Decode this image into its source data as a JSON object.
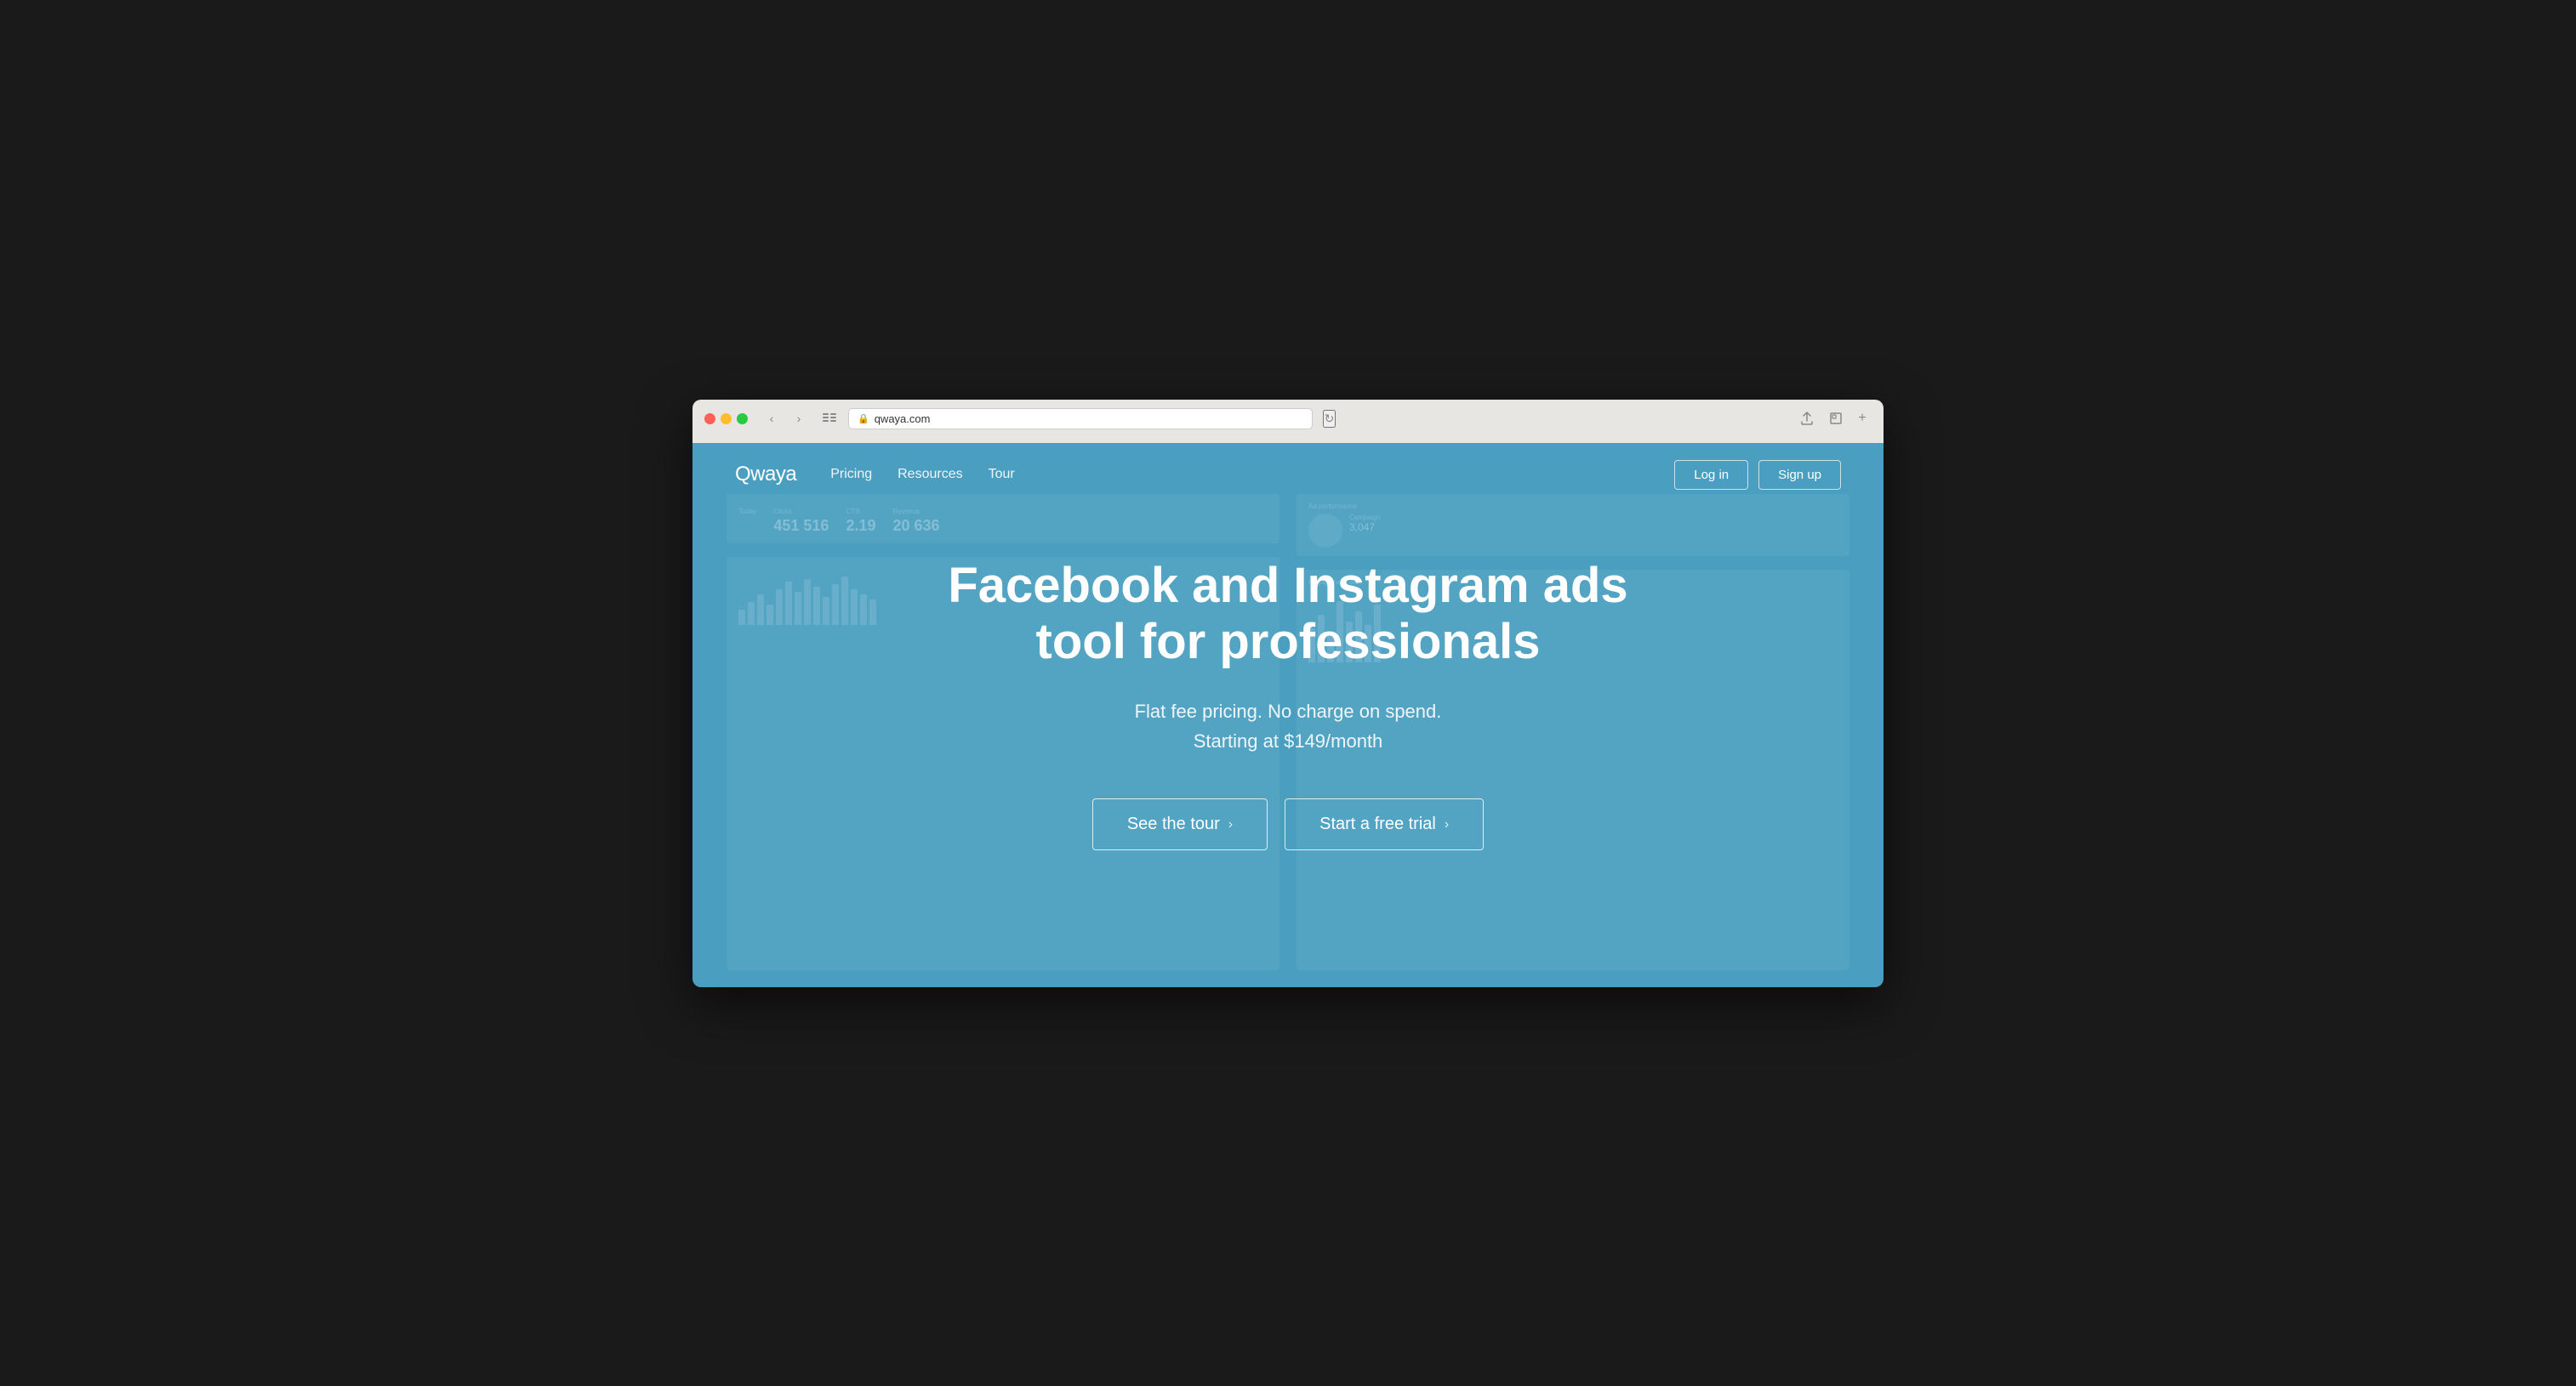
{
  "browser": {
    "url": "qwaya.com",
    "url_full": "qwaya.com"
  },
  "nav": {
    "logo": "Qwaya",
    "links": [
      {
        "label": "Pricing",
        "id": "pricing"
      },
      {
        "label": "Resources",
        "id": "resources"
      },
      {
        "label": "Tour",
        "id": "tour"
      }
    ],
    "login_label": "Log in",
    "signup_label": "Sign up"
  },
  "hero": {
    "headline": "Facebook and Instagram ads tool for professionals",
    "subtext_line1": "Flat fee pricing. No charge on spend.",
    "subtext_line2": "Starting at $149/month",
    "cta_tour": "See the tour",
    "cta_trial": "Start a free trial",
    "arrow": "›"
  },
  "bg_stats": {
    "today_label": "Today",
    "clicks_label": "Clicks",
    "clicks_value": "451 516",
    "ctr_label": "CTR",
    "ctr_value": "2.19",
    "revenue_label": "Revenue",
    "revenue_value": "20 636"
  }
}
